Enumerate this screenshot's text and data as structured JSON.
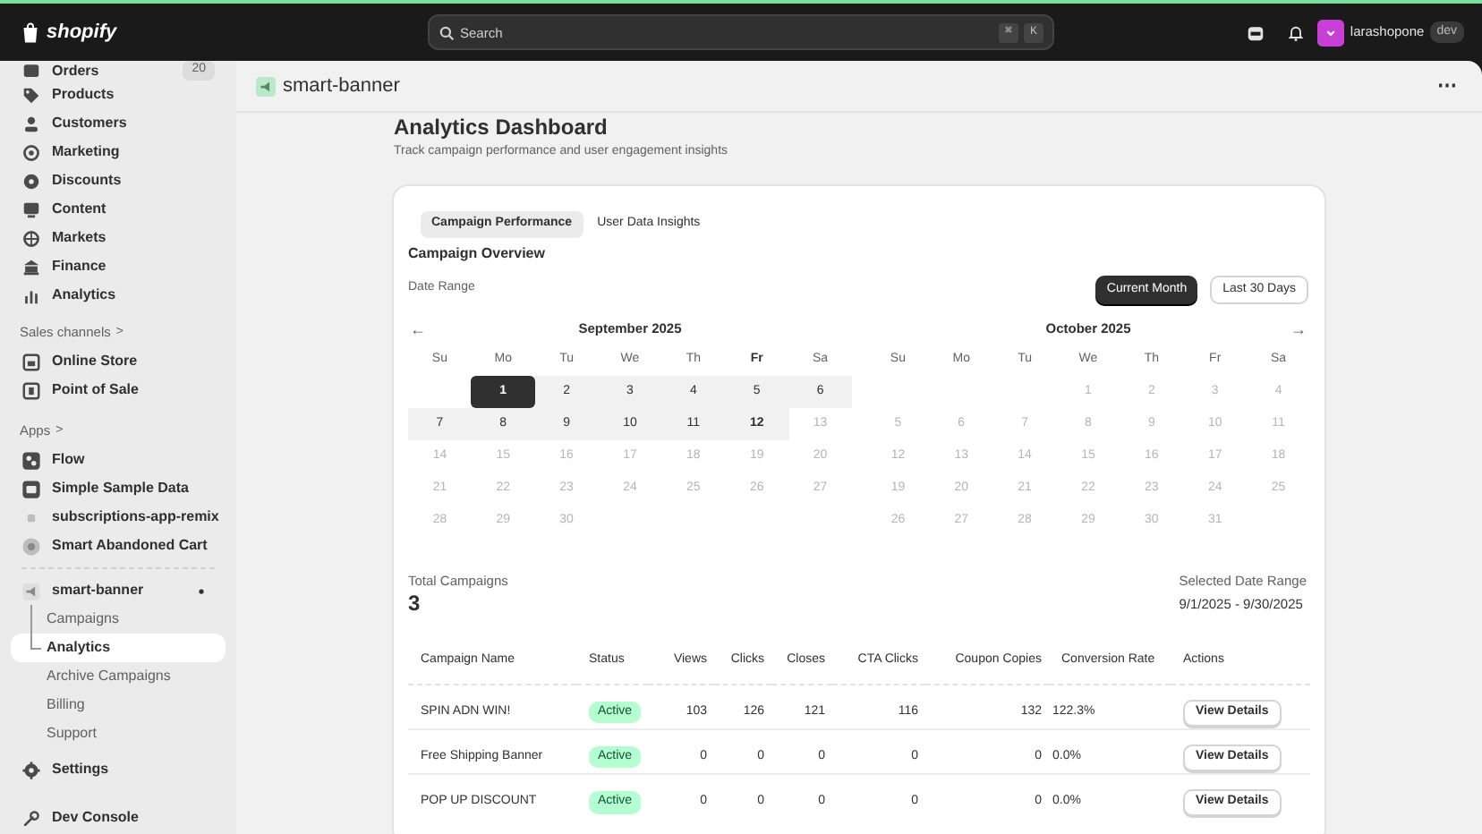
{
  "top_bar": {
    "logo": "shopify",
    "search": {
      "placeholder": "Search",
      "shortcut": [
        "⌘",
        "K"
      ]
    },
    "store": {
      "name": "larashopone",
      "badge": "dev"
    }
  },
  "sidebar": {
    "items": [
      {
        "kind": "nav",
        "label": "Orders",
        "count": "20"
      },
      {
        "kind": "nav",
        "label": "Products"
      },
      {
        "kind": "nav",
        "label": "Customers"
      },
      {
        "kind": "nav",
        "label": "Marketing"
      },
      {
        "kind": "nav",
        "label": "Discounts"
      },
      {
        "kind": "nav",
        "label": "Content"
      },
      {
        "kind": "nav",
        "label": "Markets"
      },
      {
        "kind": "nav",
        "label": "Finance"
      },
      {
        "kind": "nav",
        "label": "Analytics"
      },
      {
        "kind": "heading",
        "label": "Sales channels",
        "arrow": ">"
      },
      {
        "kind": "nav",
        "label": "Online Store"
      },
      {
        "kind": "nav",
        "label": "Point of Sale"
      },
      {
        "kind": "heading",
        "label": "Apps",
        "arrow": ">"
      },
      {
        "kind": "nav",
        "label": "Flow"
      },
      {
        "kind": "nav",
        "label": "Simple Sample Data"
      },
      {
        "kind": "nav",
        "label": "subscriptions-app-remix"
      },
      {
        "kind": "nav",
        "label": "Smart Abandoned Cart"
      },
      {
        "kind": "divider"
      },
      {
        "kind": "app",
        "label": "smart-banner",
        "pinned": true
      },
      {
        "kind": "sub",
        "label": "Campaigns",
        "selected": false
      },
      {
        "kind": "sub",
        "label": "Analytics",
        "selected": true
      },
      {
        "kind": "sub",
        "label": "Archive Campaigns",
        "selected": false
      },
      {
        "kind": "sub",
        "label": "Billing",
        "selected": false
      },
      {
        "kind": "sub",
        "label": "Support",
        "selected": false
      },
      {
        "kind": "nav",
        "label": "Settings"
      },
      {
        "kind": "footer",
        "label": "Dev Console"
      }
    ]
  },
  "app_header": {
    "title": "smart-banner",
    "menu": "⋯"
  },
  "page": {
    "title": "Analytics Dashboard",
    "subtitle": "Track campaign performance and user engagement insights"
  },
  "tabs": [
    {
      "label": "Campaign Performance",
      "selected": true
    },
    {
      "label": "User Data Insights",
      "selected": false
    }
  ],
  "overview": {
    "title": "Campaign Overview",
    "date_range_label": "Date Range",
    "range_buttons": [
      {
        "label": "Current Month",
        "selected": true
      },
      {
        "label": "Last 30 Days",
        "selected": false
      }
    ],
    "calendars": [
      {
        "title": "September 2025",
        "nav": "←",
        "weekdays": [
          "Su",
          "Mo",
          "Tu",
          "We",
          "Th",
          "Fr",
          "Sa"
        ],
        "weeks": [
          [
            {
              "day": "1",
              "in_range": true,
              "selected": true,
              "today": false
            },
            {
              "day": "2",
              "in_range": true,
              "selected": false,
              "today": false
            },
            {
              "day": "3",
              "in_range": true,
              "selected": false,
              "today": false
            },
            {
              "day": "4",
              "in_range": true,
              "selected": false,
              "today": false
            },
            {
              "day": "5",
              "in_range": true,
              "selected": false,
              "today": false
            },
            {
              "day": "6",
              "in_range": true,
              "selected": false,
              "today": false
            }
          ],
          [
            {
              "day": "7",
              "in_range": true,
              "selected": false,
              "today": false
            },
            {
              "day": "8",
              "in_range": true,
              "selected": false,
              "today": false
            },
            {
              "day": "9",
              "in_range": true,
              "selected": false,
              "today": false
            },
            {
              "day": "10",
              "in_range": true,
              "selected": false,
              "today": false
            },
            {
              "day": "11",
              "in_range": true,
              "selected": false,
              "today": false
            },
            {
              "day": "12",
              "in_range": true,
              "selected": false,
              "today": true
            },
            {
              "day": "13",
              "in_range": false,
              "selected": false,
              "today": false
            }
          ],
          [
            {
              "day": "14",
              "in_range": false,
              "selected": false,
              "today": false
            },
            {
              "day": "15",
              "in_range": false,
              "selected": false,
              "today": false
            },
            {
              "day": "16",
              "in_range": false,
              "selected": false,
              "today": false
            },
            {
              "day": "17",
              "in_range": false,
              "selected": false,
              "today": false
            },
            {
              "day": "18",
              "in_range": false,
              "selected": false,
              "today": false
            },
            {
              "day": "19",
              "in_range": false,
              "selected": false,
              "today": false
            },
            {
              "day": "20",
              "in_range": false,
              "selected": false,
              "today": false
            }
          ],
          [
            {
              "day": "21",
              "in_range": false,
              "selected": false,
              "today": false
            },
            {
              "day": "22",
              "in_range": false,
              "selected": false,
              "today": false
            },
            {
              "day": "23",
              "in_range": false,
              "selected": false,
              "today": false
            },
            {
              "day": "24",
              "in_range": false,
              "selected": false,
              "today": false
            },
            {
              "day": "25",
              "in_range": false,
              "selected": false,
              "today": false
            },
            {
              "day": "26",
              "in_range": false,
              "selected": false,
              "today": false
            },
            {
              "day": "27",
              "in_range": false,
              "selected": false,
              "today": false
            }
          ],
          [
            {
              "day": "28",
              "in_range": false,
              "selected": false,
              "today": false
            },
            {
              "day": "29",
              "in_range": false,
              "selected": false,
              "today": false
            },
            {
              "day": "30",
              "in_range": false,
              "selected": false,
              "today": false
            }
          ]
        ]
      },
      {
        "title": "October 2025",
        "nav": "→",
        "weekdays": [
          "Su",
          "Mo",
          "Tu",
          "We",
          "Th",
          "Fr",
          "Sa"
        ],
        "weeks": [
          [
            {
              "day": "1",
              "in_range": false,
              "selected": false,
              "today": false
            },
            {
              "day": "2",
              "in_range": false,
              "selected": false,
              "today": false
            },
            {
              "day": "3",
              "in_range": false,
              "selected": false,
              "today": false
            },
            {
              "day": "4",
              "in_range": false,
              "selected": false,
              "today": false
            }
          ],
          [
            {
              "day": "5",
              "in_range": false,
              "selected": false,
              "today": false
            },
            {
              "day": "6",
              "in_range": false,
              "selected": false,
              "today": false
            },
            {
              "day": "7",
              "in_range": false,
              "selected": false,
              "today": false
            },
            {
              "day": "8",
              "in_range": false,
              "selected": false,
              "today": false
            },
            {
              "day": "9",
              "in_range": false,
              "selected": false,
              "today": false
            },
            {
              "day": "10",
              "in_range": false,
              "selected": false,
              "today": false
            },
            {
              "day": "11",
              "in_range": false,
              "selected": false,
              "today": false
            }
          ],
          [
            {
              "day": "12",
              "in_range": false,
              "selected": false,
              "today": false
            },
            {
              "day": "13",
              "in_range": false,
              "selected": false,
              "today": false
            },
            {
              "day": "14",
              "in_range": false,
              "selected": false,
              "today": false
            },
            {
              "day": "15",
              "in_range": false,
              "selected": false,
              "today": false
            },
            {
              "day": "16",
              "in_range": false,
              "selected": false,
              "today": false
            },
            {
              "day": "17",
              "in_range": false,
              "selected": false,
              "today": false
            },
            {
              "day": "18",
              "in_range": false,
              "selected": false,
              "today": false
            }
          ],
          [
            {
              "day": "19",
              "in_range": false,
              "selected": false,
              "today": false
            },
            {
              "day": "20",
              "in_range": false,
              "selected": false,
              "today": false
            },
            {
              "day": "21",
              "in_range": false,
              "selected": false,
              "today": false
            },
            {
              "day": "22",
              "in_range": false,
              "selected": false,
              "today": false
            },
            {
              "day": "23",
              "in_range": false,
              "selected": false,
              "today": false
            },
            {
              "day": "24",
              "in_range": false,
              "selected": false,
              "today": false
            },
            {
              "day": "25",
              "in_range": false,
              "selected": false,
              "today": false
            }
          ],
          [
            {
              "day": "26",
              "in_range": false,
              "selected": false,
              "today": false
            },
            {
              "day": "27",
              "in_range": false,
              "selected": false,
              "today": false
            },
            {
              "day": "28",
              "in_range": false,
              "selected": false,
              "today": false
            },
            {
              "day": "29",
              "in_range": false,
              "selected": false,
              "today": false
            },
            {
              "day": "30",
              "in_range": false,
              "selected": false,
              "today": false
            },
            {
              "day": "31",
              "in_range": false,
              "selected": false,
              "today": false
            }
          ]
        ]
      }
    ],
    "total": {
      "label": "Total Campaigns",
      "value": "3"
    },
    "selected_range": {
      "label": "Selected Date Range",
      "value": "9/1/2025 - 9/30/2025"
    }
  },
  "table": {
    "columns": [
      "Campaign Name",
      "Status",
      "Views",
      "Clicks",
      "Closes",
      "CTA Clicks",
      "Coupon Copies",
      "Conversion Rate",
      "Actions"
    ],
    "rows": [
      {
        "name": "SPIN ADN WIN!",
        "status": "Active",
        "views": "103",
        "clicks": "126",
        "closes": "121",
        "cta_clicks": "116",
        "coupon_copies": "132",
        "conversion_rate": "122.3%",
        "action": "View Details"
      },
      {
        "name": "Free Shipping Banner",
        "status": "Active",
        "views": "0",
        "clicks": "0",
        "closes": "0",
        "cta_clicks": "0",
        "coupon_copies": "0",
        "conversion_rate": "0.0%",
        "action": "View Details"
      },
      {
        "name": "POP UP DISCOUNT",
        "status": "Active",
        "views": "0",
        "clicks": "0",
        "closes": "0",
        "cta_clicks": "0",
        "coupon_copies": "0",
        "conversion_rate": "0.0%",
        "action": "View Details"
      }
    ]
  }
}
